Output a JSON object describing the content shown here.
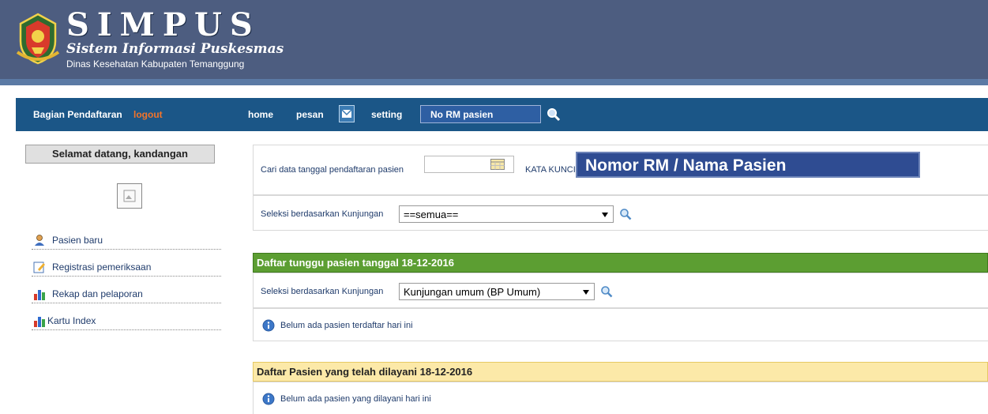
{
  "header": {
    "title": "SIMPUS",
    "subtitle": "Sistem Informasi Puskesmas",
    "agency": "Dinas Kesehatan Kabupaten Temanggung"
  },
  "nav": {
    "section": "Bagian Pendaftaran",
    "logout": "logout",
    "home": "home",
    "pesan": "pesan",
    "setting": "setting",
    "search_placeholder": "No RM pasien"
  },
  "sidebar": {
    "welcome": "Selamat datang, kandangan",
    "items": [
      {
        "label": "Pasien baru",
        "icon": "user-icon"
      },
      {
        "label": "Registrasi pemeriksaan",
        "icon": "edit-icon"
      },
      {
        "label": "Rekap dan pelaporan",
        "icon": "bar-chart-icon"
      },
      {
        "label": "Kartu Index",
        "icon": "bar-chart-icon"
      }
    ]
  },
  "search_panel": {
    "date_label": "Cari data tanggal pendaftaran pasien",
    "keyword_label": "KATA KUNCI",
    "keyword_value": "Nomor RM / Nama Pasien"
  },
  "filter_panel": {
    "label": "Seleksi berdasarkan Kunjungan",
    "selected": "==semua=="
  },
  "waiting": {
    "title": "Daftar tunggu pasien tanggal 18-12-2016",
    "filter_label": "Seleksi berdasarkan Kunjungan",
    "filter_selected": "Kunjungan umum (BP Umum)",
    "empty_message": "Belum ada pasien terdaftar hari ini"
  },
  "served": {
    "title": "Daftar Pasien yang telah dilayani 18-12-2016",
    "empty_message": "Belum ada pasien yang dilayani hari ini"
  },
  "colors": {
    "header_bg": "#4d5d80",
    "navbar_bg": "#1b5687",
    "logout": "#f3742a",
    "green_bar": "#5c9e32",
    "yellow_bar": "#fce9a8"
  }
}
